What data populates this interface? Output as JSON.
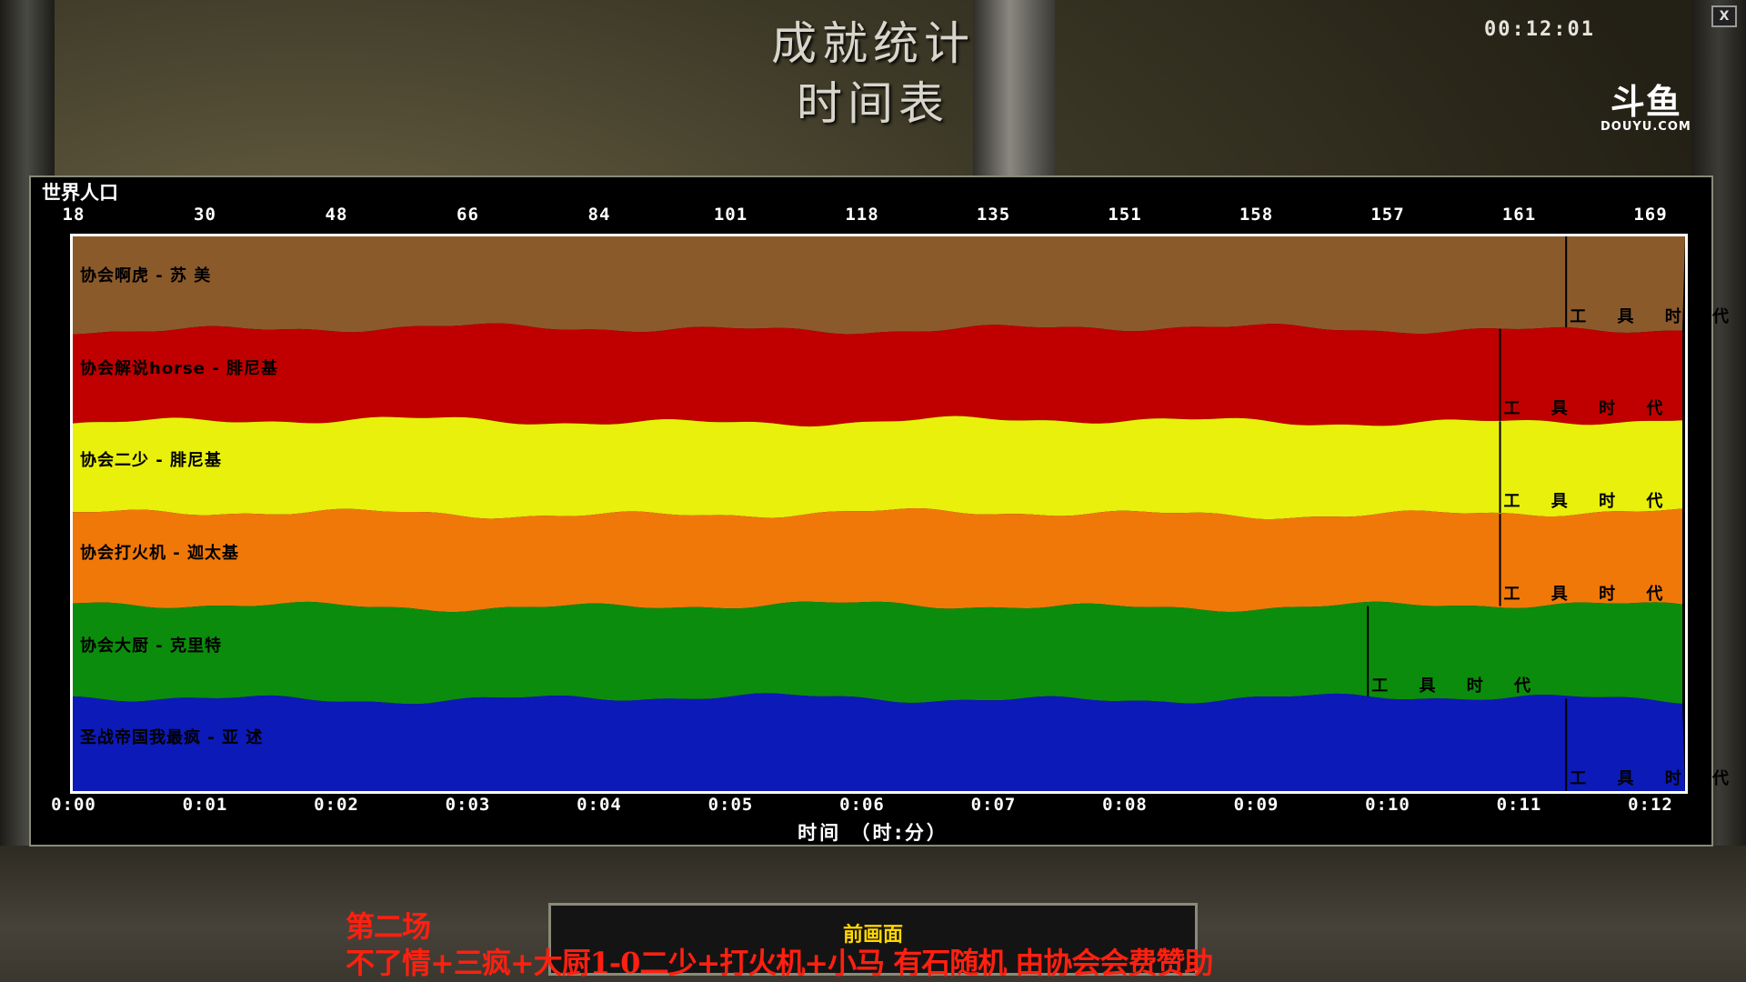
{
  "header": {
    "title": "成就统计",
    "subtitle": "时间表",
    "timer": "00:12:01",
    "close_label": "X"
  },
  "logo": {
    "text": "斗鱼",
    "url_text": "DOUYU.COM"
  },
  "chart_data": {
    "type": "area",
    "title": "世界人口",
    "xlabel": "时间 （时:分）",
    "top_tick_labels": [
      "18",
      "30",
      "48",
      "66",
      "84",
      "101",
      "118",
      "135",
      "151",
      "158",
      "157",
      "161",
      "169"
    ],
    "x_tick_labels": [
      "0:00",
      "0:01",
      "0:02",
      "0:03",
      "0:04",
      "0:05",
      "0:06",
      "0:07",
      "0:08",
      "0:09",
      "0:10",
      "0:11",
      "0:12"
    ],
    "xlim": [
      0,
      12.2
    ],
    "ylim": [
      0,
      6
    ],
    "age_label": "工 具 时 代",
    "series": [
      {
        "name": "协会啊虎 - 苏 美",
        "color": "#8b5a2b",
        "ages": [
          11.3
        ],
        "share_start": 1.0,
        "share_end": 1.0
      },
      {
        "name": "协会解说horse - 腓尼基",
        "color": "#c00000",
        "ages": [
          10.8
        ],
        "share_start": 1.0,
        "share_end": 1.0
      },
      {
        "name": "协会二少 - 腓尼基",
        "color": "#e8f00c",
        "ages": [
          10.8
        ],
        "share_start": 1.0,
        "share_end": 1.0
      },
      {
        "name": "协会打火机 - 迦太基",
        "color": "#f07808",
        "ages": [
          10.8
        ],
        "share_start": 1.0,
        "share_end": 1.0
      },
      {
        "name": "协会大厨 - 克里特",
        "color": "#0c8c0c",
        "ages": [
          9.8
        ],
        "share_start": 1.0,
        "share_end": 1.0
      },
      {
        "name": "圣战帝国我最疯 - 亚 述",
        "color": "#0c1ab8",
        "ages": [
          11.3
        ],
        "share_start": 1.0,
        "share_end": 1.0
      }
    ]
  },
  "footer": {
    "label": "前画面",
    "annotation_line1": "第二场",
    "annotation_line2": "不了情+三疯+大厨1-0二少+打火机+小马  有石随机  由协会会费赞助"
  }
}
